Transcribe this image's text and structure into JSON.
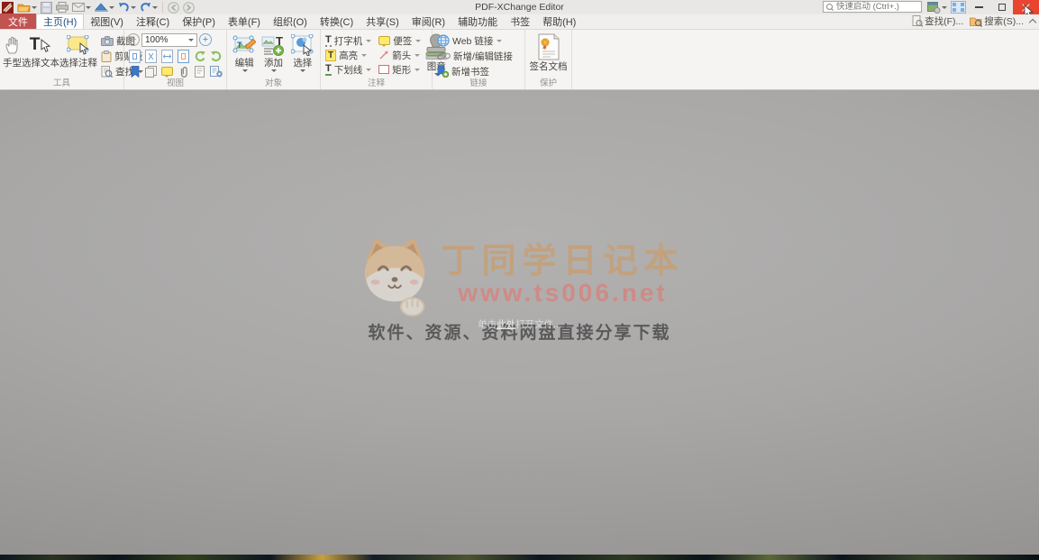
{
  "window": {
    "title": "PDF-XChange Editor"
  },
  "titlebar": {
    "search_placeholder": "快速启动 (Ctrl+.)"
  },
  "tabs": {
    "file_label": "文件",
    "active": "主页(H)",
    "items": [
      "主页(H)",
      "视图(V)",
      "注释(C)",
      "保护(P)",
      "表单(F)",
      "组织(O)",
      "转换(C)",
      "共享(S)",
      "审阅(R)",
      "辅助功能",
      "书签",
      "帮助(H)"
    ]
  },
  "tabstrip_right": {
    "find_label": "查找(F)...",
    "search_label": "搜索(S)..."
  },
  "ribbon": {
    "tools": {
      "label": "工具",
      "hand": "手型",
      "select_text": "选择文本",
      "select_comments": "选择注释",
      "snapshot": "截图",
      "clipboard": "剪贴板",
      "find": "查找"
    },
    "view": {
      "label": "视图",
      "zoom_value": "100%"
    },
    "objects": {
      "label": "对象",
      "edit": "编辑",
      "add": "添加",
      "select": "选择"
    },
    "comments": {
      "label": "注释",
      "typewriter": "打字机",
      "sticky_note": "便签",
      "highlight": "高亮",
      "arrow": "箭头",
      "underline": "下划线",
      "rectangle": "矩形",
      "stamp": "图章"
    },
    "links": {
      "label": "链接",
      "web_link": "Web 链接",
      "add_edit_link": "新增/编辑链接",
      "add_bookmark": "新增书签"
    },
    "protect": {
      "label": "保护",
      "sign_document": "签名文档"
    }
  },
  "workspace": {
    "watermark_title": "丁同学日记本",
    "watermark_url": "www.ts006.net",
    "watermark_subtitle": "软件、资源、资料网盘直接分享下载",
    "hint_prefix": "单击",
    "hint_link": "此处",
    "hint_suffix": "打开文件..."
  },
  "colors": {
    "file_tab": "#c15350",
    "close_button": "#e84430",
    "accent_blue": "#2f7bd0"
  }
}
